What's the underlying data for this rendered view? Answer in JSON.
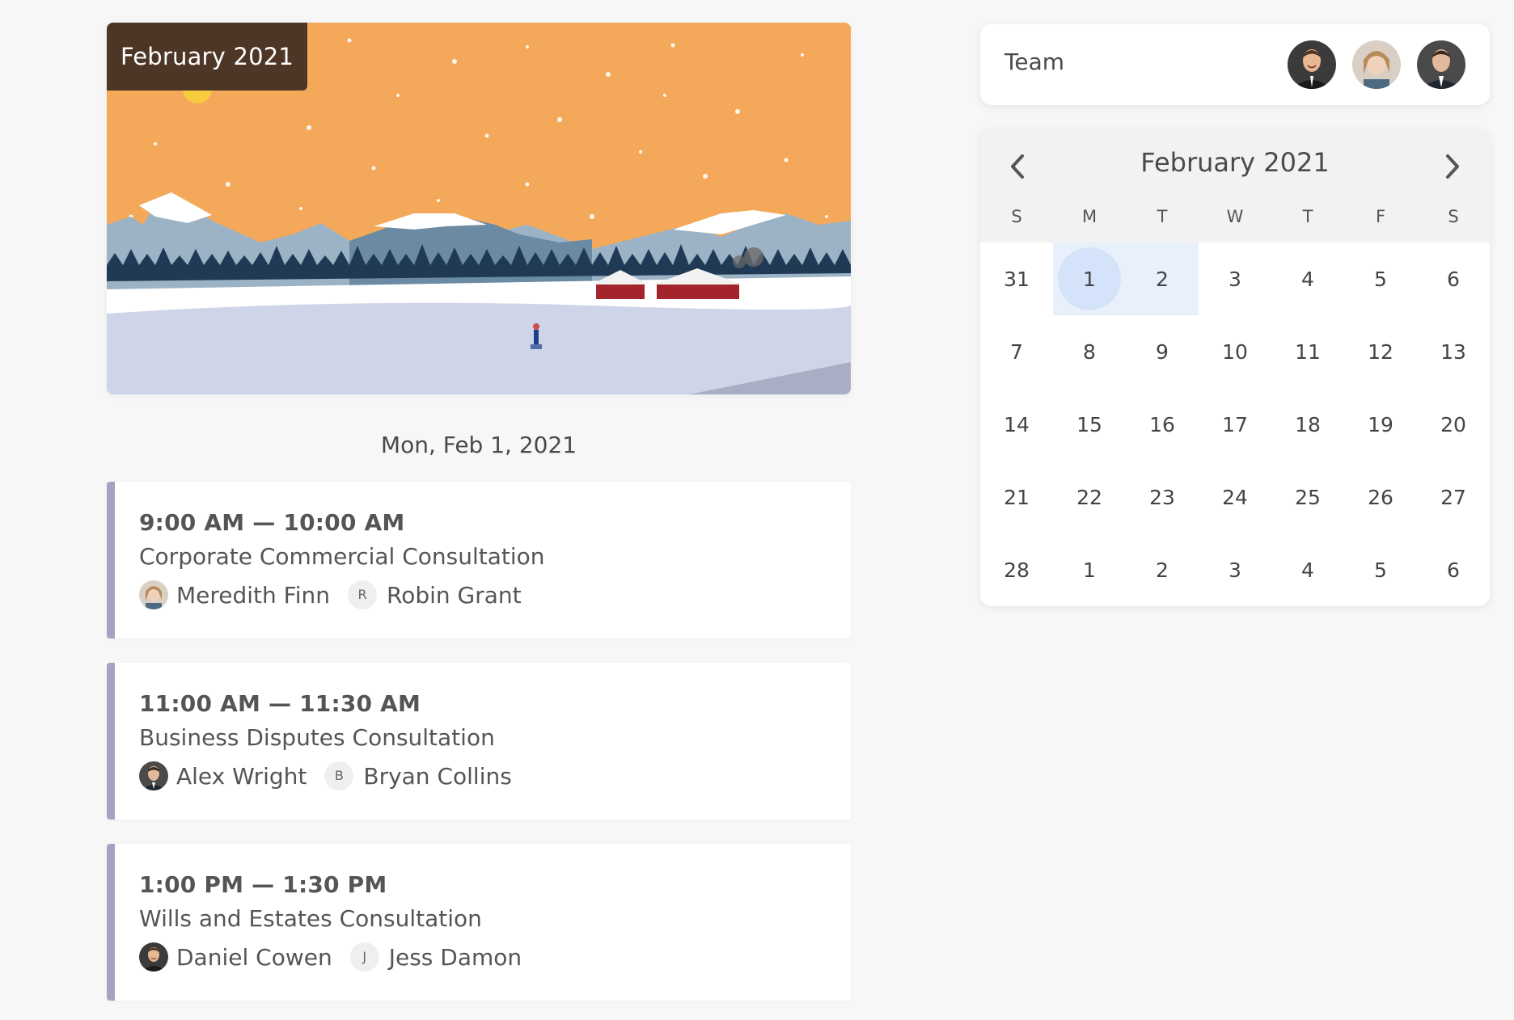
{
  "banner": {
    "month_label": "February 2021"
  },
  "day_heading": "Mon, Feb 1, 2021",
  "events": [
    {
      "time": "9:00 AM — 10:00 AM",
      "title": "Corporate Commercial Consultation",
      "attendee": {
        "name": "Meredith Finn",
        "avatar": "photo-avatar-woman"
      },
      "assignee": {
        "initial": "R",
        "name": "Robin Grant"
      }
    },
    {
      "time": "11:00 AM — 11:30 AM",
      "title": "Business Disputes Consultation",
      "attendee": {
        "name": "Alex Wright",
        "avatar": "photo-avatar-man-suit"
      },
      "assignee": {
        "initial": "B",
        "name": "Bryan Collins"
      }
    },
    {
      "time": "1:00 PM — 1:30 PM",
      "title": "Wills and Estates Consultation",
      "attendee": {
        "name": "Daniel Cowen",
        "avatar": "photo-avatar-man-smiling"
      },
      "assignee": {
        "initial": "J",
        "name": "Jess Damon"
      }
    }
  ],
  "team": {
    "label": "Team",
    "avatars": [
      "photo-avatar-man-smiling",
      "photo-avatar-woman",
      "photo-avatar-man-suit"
    ]
  },
  "calendar": {
    "title": "February 2021",
    "prev_icon": "chevron-left-icon",
    "next_icon": "chevron-right-icon",
    "weekdays": [
      "S",
      "M",
      "T",
      "W",
      "T",
      "F",
      "S"
    ],
    "weeks": [
      [
        "31",
        "1",
        "2",
        "3",
        "4",
        "5",
        "6"
      ],
      [
        "7",
        "8",
        "9",
        "10",
        "11",
        "12",
        "13"
      ],
      [
        "14",
        "15",
        "16",
        "17",
        "18",
        "19",
        "20"
      ],
      [
        "21",
        "22",
        "23",
        "24",
        "25",
        "26",
        "27"
      ],
      [
        "28",
        "1",
        "2",
        "3",
        "4",
        "5",
        "6"
      ]
    ],
    "selected_day": "1",
    "highlight_color": "#e8f0fc",
    "selected_color": "#d4e3f9"
  },
  "colors": {
    "event_bar": "#a3a3c2",
    "badge_bg": "#4d3626",
    "banner_sky": "#f4a85a"
  }
}
